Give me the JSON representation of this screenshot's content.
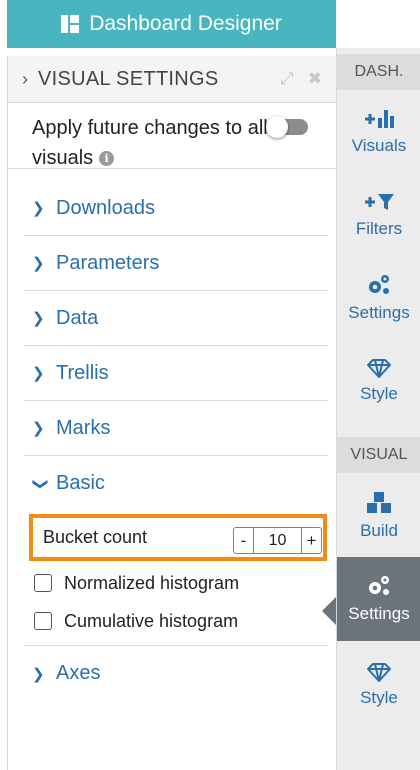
{
  "header": {
    "title": "Dashboard Designer",
    "icon": "dashboard-grid-icon"
  },
  "visual_settings": {
    "title": "VISUAL SETTINGS",
    "apply_label": "Apply future changes to all visuals",
    "apply_toggle_on": false
  },
  "sections": [
    {
      "label": "Downloads",
      "expanded": false
    },
    {
      "label": "Parameters",
      "expanded": false
    },
    {
      "label": "Data",
      "expanded": false
    },
    {
      "label": "Trellis",
      "expanded": false
    },
    {
      "label": "Marks",
      "expanded": false
    },
    {
      "label": "Basic",
      "expanded": true
    }
  ],
  "basic": {
    "bucket_label": "Bucket count",
    "bucket_value": "10",
    "minus": "-",
    "plus": "+",
    "normalized_label": "Normalized histogram",
    "normalized_checked": false,
    "cumulative_label": "Cumulative histogram",
    "cumulative_checked": false
  },
  "axes_label": "Axes",
  "rail": {
    "dash_head": "DASH.",
    "visual_head": "VISUAL",
    "dash_items": [
      "Visuals",
      "Filters",
      "Settings",
      "Style"
    ],
    "visual_items": [
      "Build",
      "Settings",
      "Style"
    ],
    "active_item": "Settings"
  },
  "colors": {
    "header": "#49b6bf",
    "accent_blue": "#2a6eab",
    "highlight": "#f28c17",
    "active_rail": "#6b747c"
  }
}
